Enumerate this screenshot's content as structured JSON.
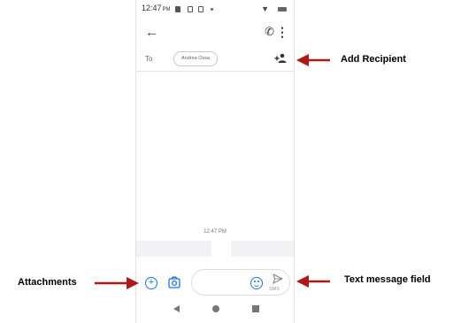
{
  "status_bar": {
    "time": "12:47",
    "time_suffix": "PM"
  },
  "header": {
    "back_icon": "arrow-back-icon",
    "call_icon": "phone-icon",
    "more_icon": "more-vert-icon"
  },
  "recipient_bar": {
    "to_label": "To",
    "recipient_chip": "Andrea Ossa",
    "add_icon": "add-person-icon"
  },
  "thread": {
    "timestamp": "12:47 PM"
  },
  "compose": {
    "attach_icon": "plus-circle-icon",
    "gallery_icon": "gallery-icon",
    "emoji_icon": "emoji-icon",
    "send_icon": "send-icon",
    "send_label": "SMS"
  },
  "annotations": {
    "add_recipient": "Add Recipient",
    "attachments": "Attachments",
    "text_field": "Text message field"
  },
  "colors": {
    "accent": "#1a73e8",
    "arrow": "#b01717"
  }
}
